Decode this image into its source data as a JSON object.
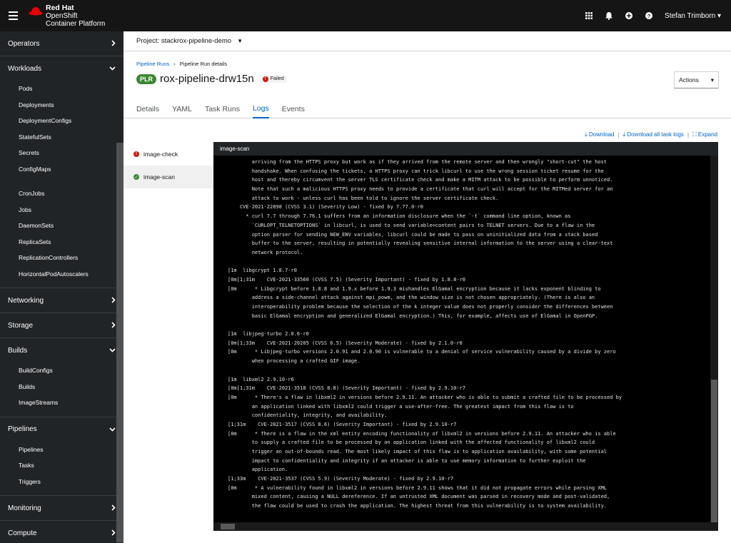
{
  "masthead": {
    "brand_line1": "Red Hat",
    "brand_line2": "OpenShift",
    "brand_line3": "Container Platform",
    "user_name": "Stefan Trimborn",
    "icons": [
      "grid-icon",
      "bell-icon",
      "plus-circle-icon",
      "help-icon"
    ]
  },
  "sidebar": {
    "sections": [
      {
        "label": "Operators",
        "expanded": false,
        "items": []
      },
      {
        "label": "Workloads",
        "expanded": true,
        "items": [
          "Pods",
          "Deployments",
          "DeploymentConfigs",
          "StatefulSets",
          "Secrets",
          "ConfigMaps",
          "",
          "CronJobs",
          "Jobs",
          "DaemonSets",
          "ReplicaSets",
          "ReplicationControllers",
          "HorizontalPodAutoscalers"
        ]
      },
      {
        "label": "Networking",
        "expanded": false,
        "items": []
      },
      {
        "label": "Storage",
        "expanded": false,
        "items": []
      },
      {
        "label": "Builds",
        "expanded": true,
        "items": [
          "BuildConfigs",
          "Builds",
          "ImageStreams"
        ]
      },
      {
        "label": "Pipelines",
        "expanded": true,
        "items": [
          "Pipelines",
          "Tasks",
          "Triggers"
        ]
      },
      {
        "label": "Monitoring",
        "expanded": false,
        "items": []
      },
      {
        "label": "Compute",
        "expanded": false,
        "items": []
      }
    ]
  },
  "project": {
    "label": "Project: stackrox-pipeline-demo"
  },
  "breadcrumb": {
    "link": "Pipeline Runs",
    "current": "Pipeline Run details"
  },
  "header": {
    "badge": "PLR",
    "title": "rox-pipeline-drw15n",
    "status": "Failed",
    "actions_label": "Actions"
  },
  "tabs": [
    "Details",
    "YAML",
    "Task Runs",
    "Logs",
    "Events"
  ],
  "active_tab": "Logs",
  "downloads": {
    "download": "Download",
    "download_all": "Download all task logs",
    "expand": "Expand"
  },
  "tasks": [
    {
      "name": "image-check",
      "status": "failed"
    },
    {
      "name": "image-scan",
      "status": "succeeded"
    }
  ],
  "log": {
    "title": "image-scan",
    "lines": [
      "        arriving from the HTTPS proxy but work as if they arrived from the remote server and then wrongly \"short-cut\" the host",
      "        handshake. When confusing the tickets, a HTTPS proxy can trick libcurl to use the wrong session ticket resume for the",
      "        host and thereby circumvent the server TLS certificate check and make a MITM attack to be possible to perform unnoticed.",
      "        Note that such a malicious HTTPS proxy needs to provide a certificate that curl will accept for the MITMed server for an",
      "        attack to work - unless curl has been told to ignore the server certificate check.",
      "    CVE-2021-22898 (CVSS 3.1) (Severity Low) - fixed by 7.77.0-r0",
      "      * curl 7.7 through 7.76.1 suffers from an information disclosure when the `-t` command line option, known as",
      "        `CURLOPT_TELNETOPTIONS` in libcurl, is used to send variable=content pairs to TELNET servers. Due to a flaw in the",
      "        option parser for sending NEW_ENV variables, libcurl could be made to pass on uninitialized data from a stack based",
      "        buffer to the server, resulting in potentially revealing sensitive internal information to the server using a clear-text",
      "        network protocol.",
      "",
      "[1m  libgcrypt 1.8.7-r0",
      "[0m[1;31m    CVE-2021-33560 (CVSS 7.5) (Severity Important) - fixed by 1.8.8-r0",
      "[0m      * Libgcrypt before 1.8.8 and 1.9.x before 1.9.3 mishandles ElGamal encryption because it lacks exponent blinding to",
      "        address a side-channel attack against mpi_powm, and the window size is not chosen appropriately. (There is also an",
      "        interoperability problem because the selection of the k integer value does not properly consider the differences between",
      "        basic ElGamal encryption and generalized ElGamal encryption.) This, for example, affects use of ElGamal in OpenPGP.",
      "",
      "[1m  libjpeg-turbo 2.0.6-r0",
      "[0m[1;33m    CVE-2021-20205 (CVSS 6.5) (Severity Moderate) - fixed by 2.1.0-r0",
      "[0m      * Libjpeg-turbo versions 2.0.91 and 2.0.90 is vulnerable to a denial of service vulnerability caused by a divide by zero",
      "        when processing a crafted GIF image.",
      "",
      "[1m  libxml2 2.9.10-r6",
      "[0m[1;31m    CVE-2021-3518 (CVSS 8.8) (Severity Important) - fixed by 2.9.10-r7",
      "[0m      * There's a flaw in libxml2 in versions before 2.9.11. An attacker who is able to submit a crafted file to be processed by",
      "        an application linked with libxml2 could trigger a use-after-free. The greatest impact from this flaw is to",
      "        confidentiality, integrity, and availability.",
      "[1;31m    CVE-2021-3517 (CVSS 8.6) (Severity Important) - fixed by 2.9.10-r7",
      "[0m      * There is a flaw in the xml entity encoding functionality of libxml2 in versions before 2.9.11. An attacker who is able",
      "        to supply a crafted file to be processed by an application linked with the affected functionality of libxml2 could",
      "        trigger an out-of-bounds read. The most likely impact of this flaw is to application availability, with some potential",
      "        impact to confidentiality and integrity if an attacker is able to use memory information to further exploit the",
      "        application.",
      "[1;33m    CVE-2021-3537 (CVSS 5.9) (Severity Moderate) - fixed by 2.9.10-r7",
      "[0m      * A vulnerability found in libxml2 in versions before 2.9.11 shows that it did not propagate errors while parsing XML",
      "        mixed content, causing a NULL dereference. If an untrusted XML document was parsed in recovery mode and post-validated,",
      "        the flaw could be used to crash the application. The highest threat from this vulnerability is to system availability."
    ]
  }
}
